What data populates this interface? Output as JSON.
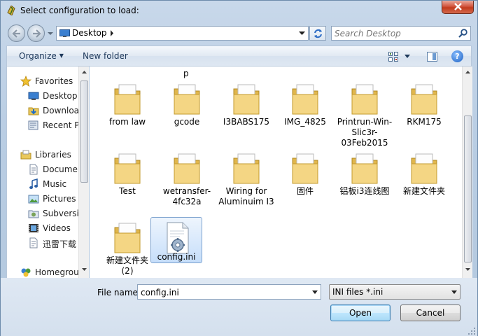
{
  "window": {
    "title": "Select configuration to load:",
    "colors": {
      "accent": "#3c7fb1",
      "close": "#c23b1d",
      "folder": "#f2d27a",
      "selection": "#c6defa"
    }
  },
  "address": {
    "location": "Desktop",
    "search_placeholder": "Search Desktop"
  },
  "commandbar": {
    "organize": "Organize",
    "new_folder": "New folder"
  },
  "nav": {
    "favorites_header": "Favorites",
    "favorites": [
      {
        "label": "Desktop",
        "icon": "desktop-icon"
      },
      {
        "label": "Downloads",
        "icon": "downloads-icon"
      },
      {
        "label": "Recent Places",
        "icon": "recent-places-icon"
      }
    ],
    "libraries_header": "Libraries",
    "libraries": [
      {
        "label": "Documents",
        "icon": "documents-icon"
      },
      {
        "label": "Music",
        "icon": "music-icon"
      },
      {
        "label": "Pictures",
        "icon": "pictures-icon"
      },
      {
        "label": "Subversion",
        "icon": "subversion-icon"
      },
      {
        "label": "Videos",
        "icon": "videos-icon"
      },
      {
        "label": "迅雷下载",
        "icon": "thunder-downloads-icon"
      }
    ],
    "homegroup": "Homegroup"
  },
  "files": {
    "top_partial_label": "p",
    "items": [
      {
        "name": "from law",
        "kind": "folder"
      },
      {
        "name": "gcode",
        "kind": "folder"
      },
      {
        "name": "I3BABS175",
        "kind": "folder"
      },
      {
        "name": "IMG_4825",
        "kind": "folder"
      },
      {
        "name": "Printrun-Win-Slic3r-03Feb2015",
        "kind": "folder"
      },
      {
        "name": "RKM175",
        "kind": "folder"
      },
      {
        "name": "Test",
        "kind": "folder"
      },
      {
        "name": "wetransfer-4fc32a",
        "kind": "folder"
      },
      {
        "name": "Wiring for Aluminuim I3",
        "kind": "folder"
      },
      {
        "name": "固件",
        "kind": "folder"
      },
      {
        "name": "铝板i3连线图",
        "kind": "folder"
      },
      {
        "name": "新建文件夹",
        "kind": "folder"
      },
      {
        "name": "新建文件夹 (2)",
        "kind": "folder"
      },
      {
        "name": "config.ini",
        "kind": "ini-file",
        "selected": true
      }
    ]
  },
  "bottom": {
    "file_name_label": "File name:",
    "file_name_value": "config.ini",
    "file_type": "INI files *.ini",
    "open": "Open",
    "cancel": "Cancel"
  }
}
